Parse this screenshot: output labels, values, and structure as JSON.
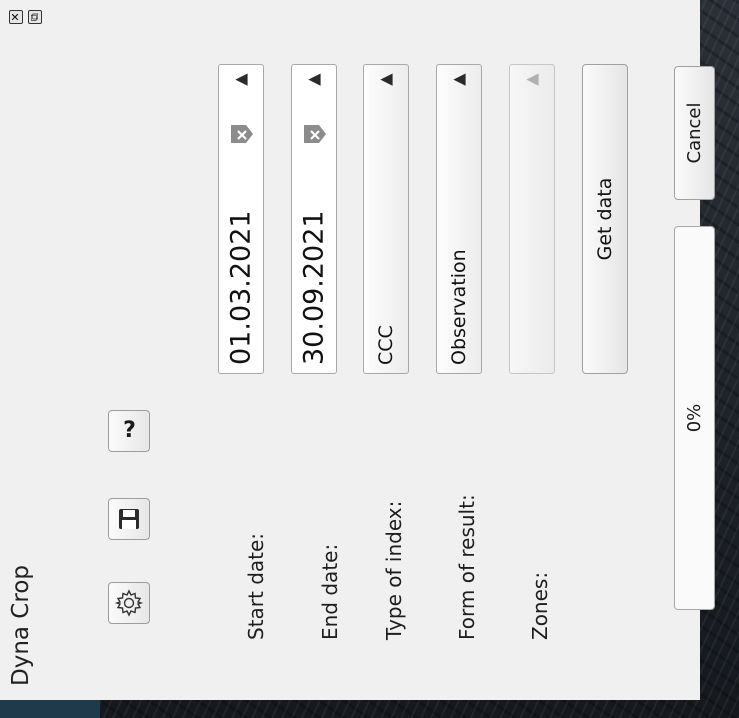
{
  "window": {
    "title": "Dyna Crop"
  },
  "toolbar": {
    "help_label": "?"
  },
  "form": {
    "start_date": {
      "label": "Start date:",
      "value": "01.03.2021"
    },
    "end_date": {
      "label": "End date:",
      "value": "30.09.2021"
    },
    "index_type": {
      "label": "Type of index:",
      "value": "CCC"
    },
    "result_form": {
      "label": "Form of result:",
      "value": "Observation"
    },
    "zones": {
      "label": "Zones:",
      "value": ""
    }
  },
  "actions": {
    "get_data": "Get data",
    "cancel": "Cancel"
  },
  "progress": {
    "value": 0,
    "text": "0%"
  }
}
